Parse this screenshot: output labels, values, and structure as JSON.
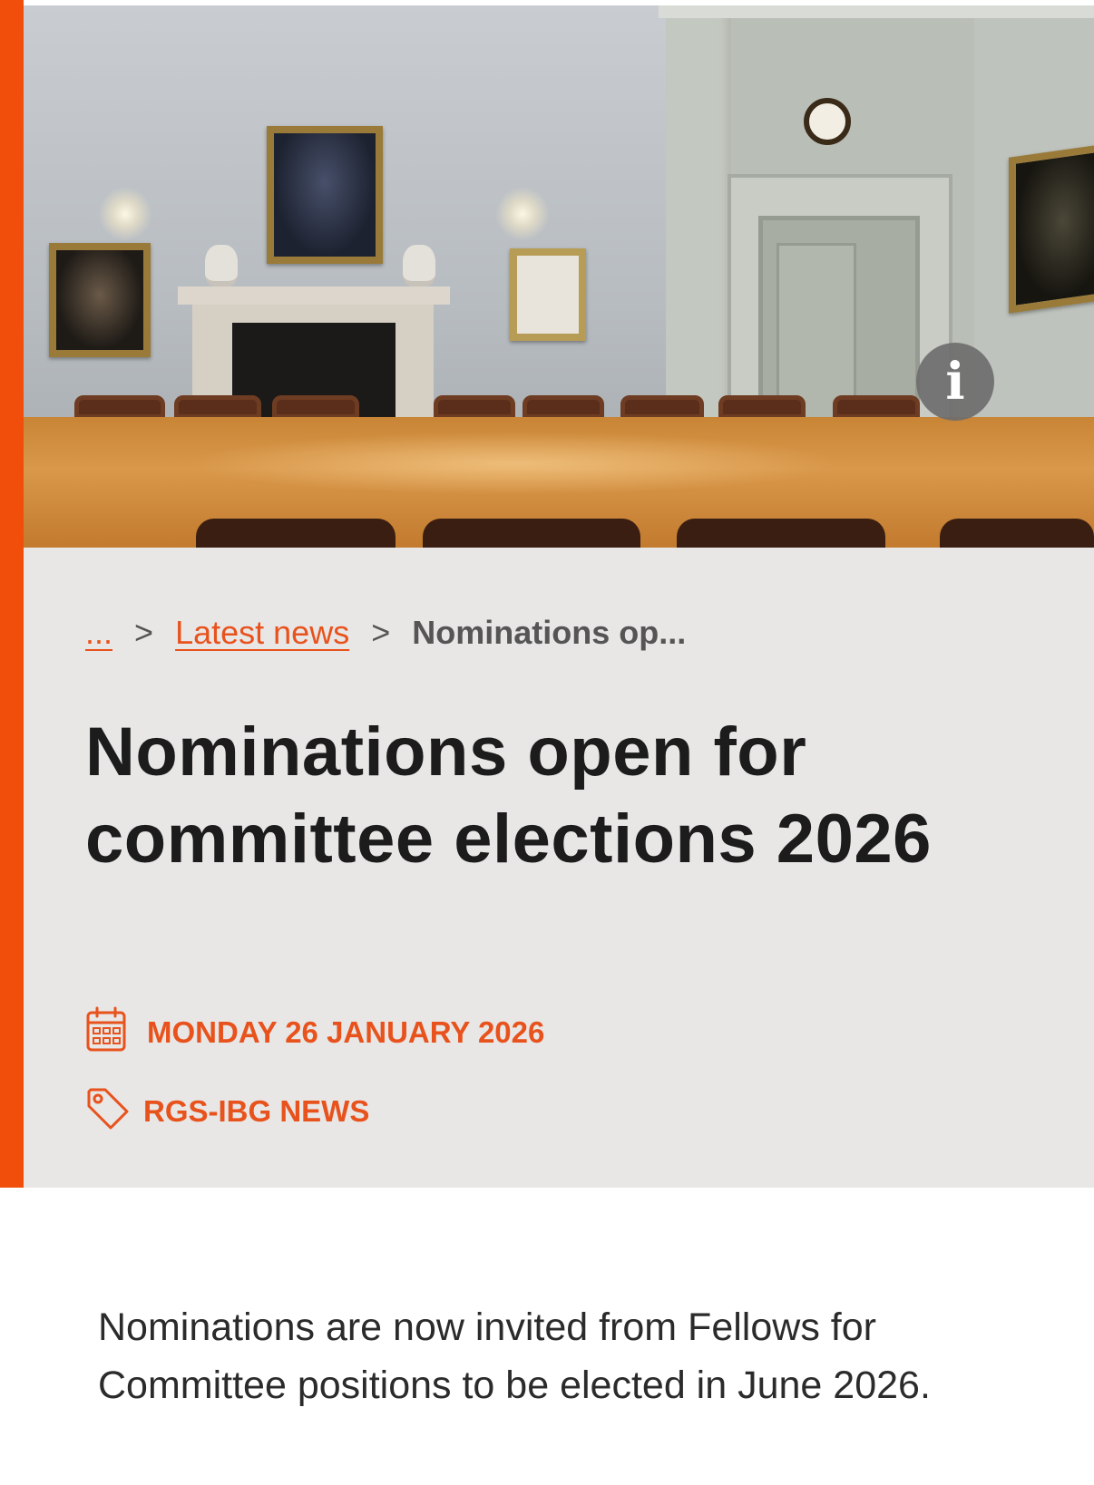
{
  "hero": {
    "info_label": "i"
  },
  "breadcrumb": {
    "ellipsis": "...",
    "separator": ">",
    "parent": "Latest news",
    "current": "Nominations op..."
  },
  "article": {
    "title": "Nominations open for committee elections 2026",
    "date": "MONDAY 26 JANUARY 2026",
    "category": "RGS-IBG NEWS",
    "intro": "Nominations are now invited from Fellows for Committee positions to be elected in June 2026."
  },
  "colors": {
    "accent": "#f04e0a",
    "link": "#e8521c",
    "panel": "#e8e7e6",
    "title": "#1c1c1c"
  },
  "icons": {
    "date": "calendar-icon",
    "category": "tag-icon",
    "info": "info-icon"
  }
}
